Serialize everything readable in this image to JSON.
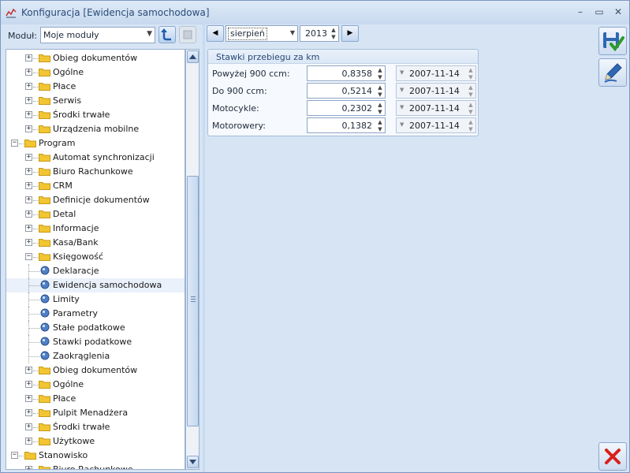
{
  "window": {
    "title": "Konfiguracja [Ewidencja samochodowa]",
    "controls": {
      "minimize": "–",
      "maximize": "▭",
      "close": "✕"
    }
  },
  "left": {
    "modul_label": "Moduł:",
    "modul_value": "Moje moduły",
    "tree": [
      {
        "label": "Obieg dokumentów",
        "level": 1,
        "kind": "folder",
        "expander": "+"
      },
      {
        "label": "Ogólne",
        "level": 1,
        "kind": "folder",
        "expander": "+"
      },
      {
        "label": "Płace",
        "level": 1,
        "kind": "folder",
        "expander": "+"
      },
      {
        "label": "Serwis",
        "level": 1,
        "kind": "folder",
        "expander": "+"
      },
      {
        "label": "Środki trwałe",
        "level": 1,
        "kind": "folder",
        "expander": "+"
      },
      {
        "label": "Urządzenia mobilne",
        "level": 1,
        "kind": "folder",
        "expander": "+"
      },
      {
        "label": "Program",
        "level": 0,
        "kind": "folder",
        "expander": "−"
      },
      {
        "label": "Automat synchronizacji",
        "level": 1,
        "kind": "folder",
        "expander": "+"
      },
      {
        "label": "Biuro Rachunkowe",
        "level": 1,
        "kind": "folder",
        "expander": "+"
      },
      {
        "label": "CRM",
        "level": 1,
        "kind": "folder",
        "expander": "+"
      },
      {
        "label": "Definicje dokumentów",
        "level": 1,
        "kind": "folder",
        "expander": "+"
      },
      {
        "label": "Detal",
        "level": 1,
        "kind": "folder",
        "expander": "+"
      },
      {
        "label": "Informacje",
        "level": 1,
        "kind": "folder",
        "expander": "+"
      },
      {
        "label": "Kasa/Bank",
        "level": 1,
        "kind": "folder",
        "expander": "+"
      },
      {
        "label": "Księgowość",
        "level": 1,
        "kind": "folder",
        "expander": "−"
      },
      {
        "label": "Deklaracje",
        "level": 2,
        "kind": "leaf"
      },
      {
        "label": "Ewidencja samochodowa",
        "level": 2,
        "kind": "leaf",
        "selected": true
      },
      {
        "label": "Limity",
        "level": 2,
        "kind": "leaf"
      },
      {
        "label": "Parametry",
        "level": 2,
        "kind": "leaf"
      },
      {
        "label": "Stałe podatkowe",
        "level": 2,
        "kind": "leaf"
      },
      {
        "label": "Stawki podatkowe",
        "level": 2,
        "kind": "leaf"
      },
      {
        "label": "Zaokrąglenia",
        "level": 2,
        "kind": "leaf"
      },
      {
        "label": "Obieg dokumentów",
        "level": 1,
        "kind": "folder",
        "expander": "+"
      },
      {
        "label": "Ogólne",
        "level": 1,
        "kind": "folder",
        "expander": "+"
      },
      {
        "label": "Płace",
        "level": 1,
        "kind": "folder",
        "expander": "+"
      },
      {
        "label": "Pulpit Menadżera",
        "level": 1,
        "kind": "folder",
        "expander": "+"
      },
      {
        "label": "Środki trwałe",
        "level": 1,
        "kind": "folder",
        "expander": "+"
      },
      {
        "label": "Użytkowe",
        "level": 1,
        "kind": "folder",
        "expander": "+"
      },
      {
        "label": "Stanowisko",
        "level": 0,
        "kind": "folder",
        "expander": "−"
      },
      {
        "label": "Biuro Rachunkowe",
        "level": 1,
        "kind": "folder",
        "expander": "+"
      }
    ]
  },
  "period": {
    "prev": "◀",
    "next": "▶",
    "month": "sierpień",
    "year": "2013"
  },
  "rates": {
    "title": "Stawki przebiegu za km",
    "rows": [
      {
        "label": "Powyżej 900 ccm:",
        "value": "0,8358",
        "date": "2007-11-14"
      },
      {
        "label": "Do 900 ccm:",
        "value": "0,5214",
        "date": "2007-11-14"
      },
      {
        "label": "Motocykle:",
        "value": "0,2302",
        "date": "2007-11-14"
      },
      {
        "label": "Motorowery:",
        "value": "0,1382",
        "date": "2007-11-14"
      }
    ]
  },
  "icons": {
    "app": "chart-line-icon",
    "refresh": "refresh-arrow-icon",
    "save": "floppy-disk-check-icon",
    "edit": "pencil-edit-icon",
    "cancel": "red-x-icon"
  },
  "colors": {
    "accent": "#2b4c79",
    "selection": "#eaf1fb",
    "folder": "#f2c532",
    "cancel_red": "#d8201a",
    "save_green": "#2c9a2c"
  }
}
